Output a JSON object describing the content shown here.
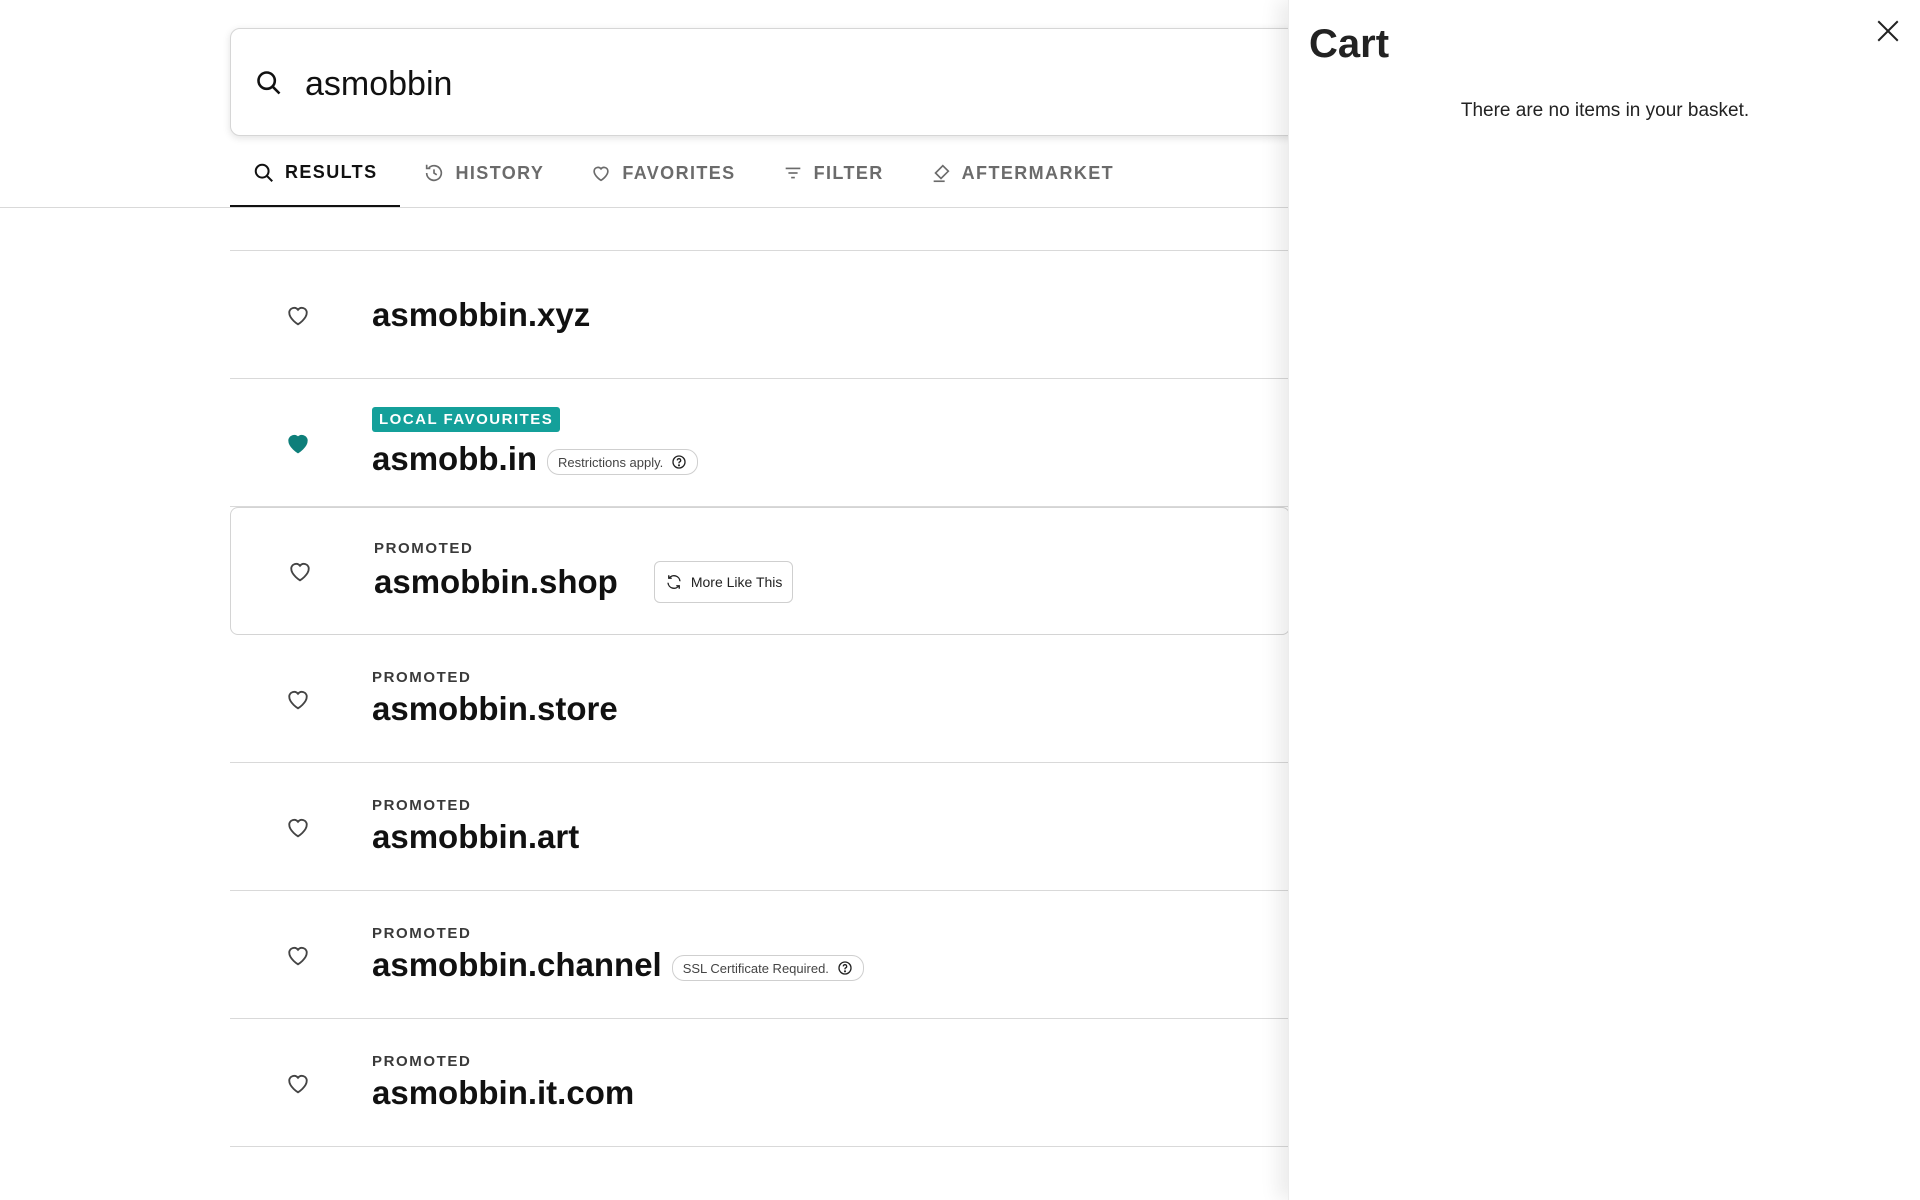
{
  "search": {
    "value": "asmobbin"
  },
  "tabs": [
    {
      "label": "RESULTS",
      "icon": "search-icon",
      "active": true
    },
    {
      "label": "HISTORY",
      "icon": "history-icon",
      "active": false
    },
    {
      "label": "FAVORITES",
      "icon": "heart-outline-icon",
      "active": false
    },
    {
      "label": "FILTER",
      "icon": "filter-icon",
      "active": false
    },
    {
      "label": "AFTERMARKET",
      "icon": "gavel-icon",
      "active": false
    }
  ],
  "results": [
    {
      "domain": "asmobbin.xyz",
      "favorited": false
    },
    {
      "domain": "asmobb.in",
      "badge": "LOCAL FAVOURITES",
      "note": "Restrictions apply.",
      "favorited": true
    },
    {
      "domain": "asmobbin.shop",
      "label": "PROMOTED",
      "action": "More Like This",
      "favorited": false
    },
    {
      "domain": "asmobbin.store",
      "label": "PROMOTED",
      "favorited": false
    },
    {
      "domain": "asmobbin.art",
      "label": "PROMOTED",
      "favorited": false
    },
    {
      "domain": "asmobbin.channel",
      "label": "PROMOTED",
      "note": "SSL Certificate Required.",
      "favorited": false
    },
    {
      "domain": "asmobbin.it.com",
      "label": "PROMOTED",
      "favorited": false
    }
  ],
  "cart": {
    "title": "Cart",
    "empty_message": "There are no items in your basket."
  },
  "colors": {
    "accent": "#14a09a",
    "favorited_heart": "#0e7f7a",
    "text": "#111111"
  }
}
